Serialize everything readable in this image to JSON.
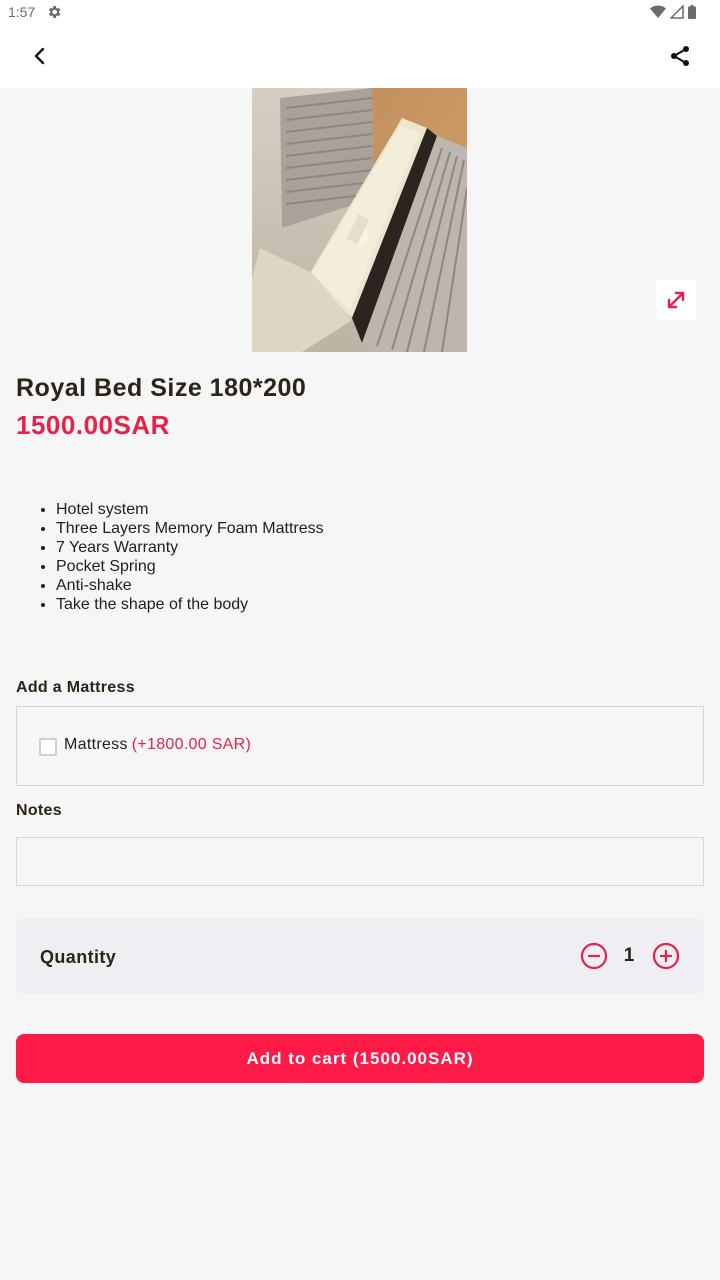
{
  "status_bar": {
    "time": "1:57",
    "icons": [
      "gear-icon",
      "wifi-icon",
      "signal-icon",
      "battery-icon"
    ]
  },
  "app_bar": {
    "back_icon": "chevron-left-icon",
    "share_icon": "share-icon"
  },
  "product": {
    "title": "Royal Bed Size 180*200",
    "price": "1500.00SAR",
    "features": [
      "Hotel system",
      "Three Layers Memory Foam Mattress",
      "7 Years Warranty",
      "Pocket Spring",
      "Anti-shake",
      "Take the shape of the body"
    ]
  },
  "addon": {
    "section_label": "Add a Mattress",
    "option_label": "Mattress",
    "option_price": "(+1800.00 SAR)",
    "checked": false
  },
  "notes": {
    "label": "Notes",
    "value": "",
    "placeholder": ""
  },
  "quantity": {
    "label": "Quantity",
    "value": "1"
  },
  "cart": {
    "button_label": "Add to cart (1500.00SAR)"
  },
  "colors": {
    "accent": "#e8214b",
    "button": "#ff1a47",
    "background": "#f6f6f6"
  }
}
